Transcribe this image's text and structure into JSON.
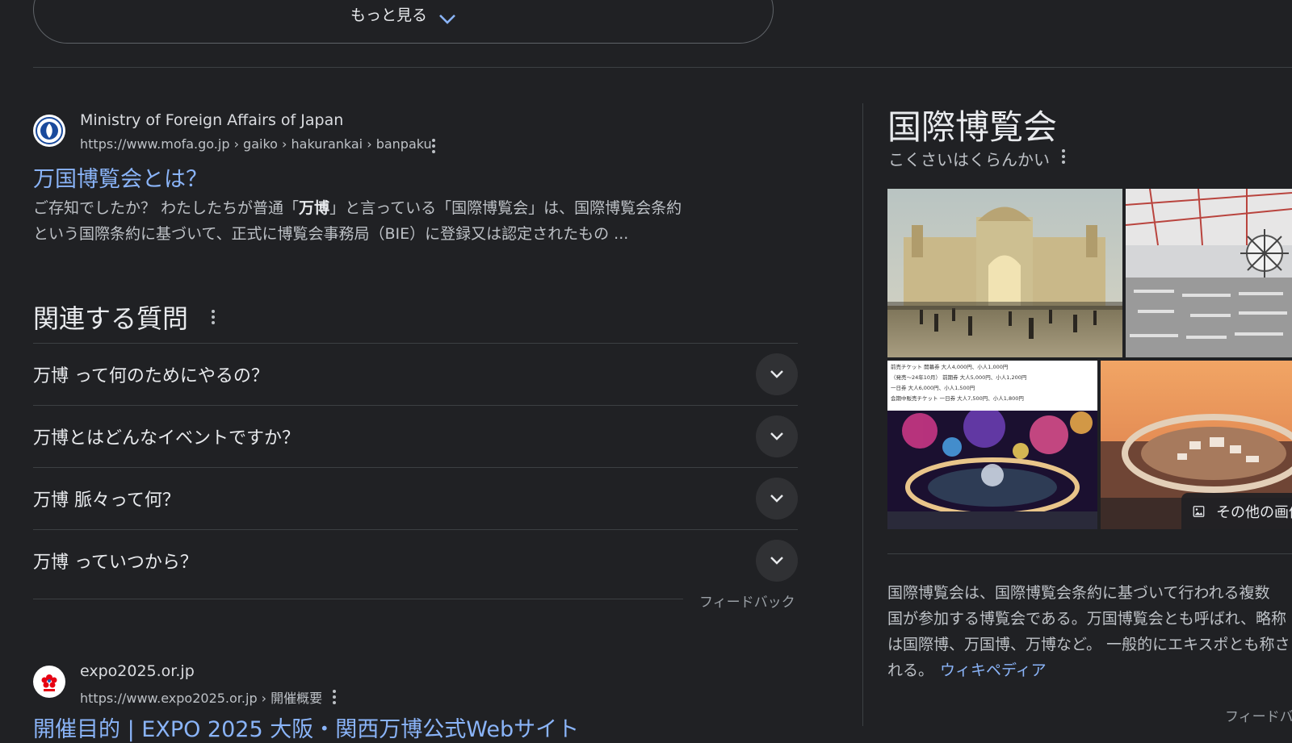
{
  "more_button": {
    "label": "もっと見る"
  },
  "result1": {
    "site_name": "Ministry of Foreign Affairs of Japan",
    "url": "https://www.mofa.go.jp › gaiko › hakurankai › banpaku",
    "title": "万国博覧会とは？",
    "snippet_line1_a": "ご存知でしたか？ わたしたちが普通「",
    "snippet_line1_bold": "万博",
    "snippet_line1_b": "」と言っている「国際博覧会」は、国際博覧会条約",
    "snippet_line2": "という国際条約に基づいて、正式に博覧会事務局（BIE）に登録又は認定されたもの ..."
  },
  "related_questions": {
    "heading": "関連する質問",
    "items": [
      {
        "question": "万博 って何のためにやるの？"
      },
      {
        "question": "万博とはどんなイベントですか？"
      },
      {
        "question": "万博 脈々って何？"
      },
      {
        "question": "万博 っていつから？"
      }
    ],
    "feedback": "フィードバック"
  },
  "result2": {
    "site_name": "expo2025.or.jp",
    "url": "https://www.expo2025.or.jp › 開催概要",
    "title": "開催目的 | EXPO 2025 大阪・関西万博公式Webサイト"
  },
  "knowledge_panel": {
    "title": "国際博覧会",
    "reading": "こくさいはくらんかい",
    "more_images": "その他の画像",
    "description_lines": [
      "国際博覧会は、国際博覧会条約に基づいて行われる複数",
      "国が参加する博覧会である。万国博覧会とも呼ばれ、略称",
      "は国際博、万国博、万博など。 一般的にエキスポとも称さ",
      "れる。"
    ],
    "source_link": "ウィキペディア",
    "feedback": "フィードバック",
    "ticket_lines": [
      "前売チケット 開幕券 大人4,000円、小人1,000円",
      "（発売〜24年10月） 前期券 大人5,000円、小人1,200円",
      "一日券 大人6,000円、小人1,500円",
      "会期中販売チケット 一日券 大人7,500円、小人1,800円"
    ]
  },
  "colors": {
    "background": "#202124",
    "link": "#8ab4f8",
    "text": "#e8eaed",
    "muted": "#bdc1c6"
  }
}
